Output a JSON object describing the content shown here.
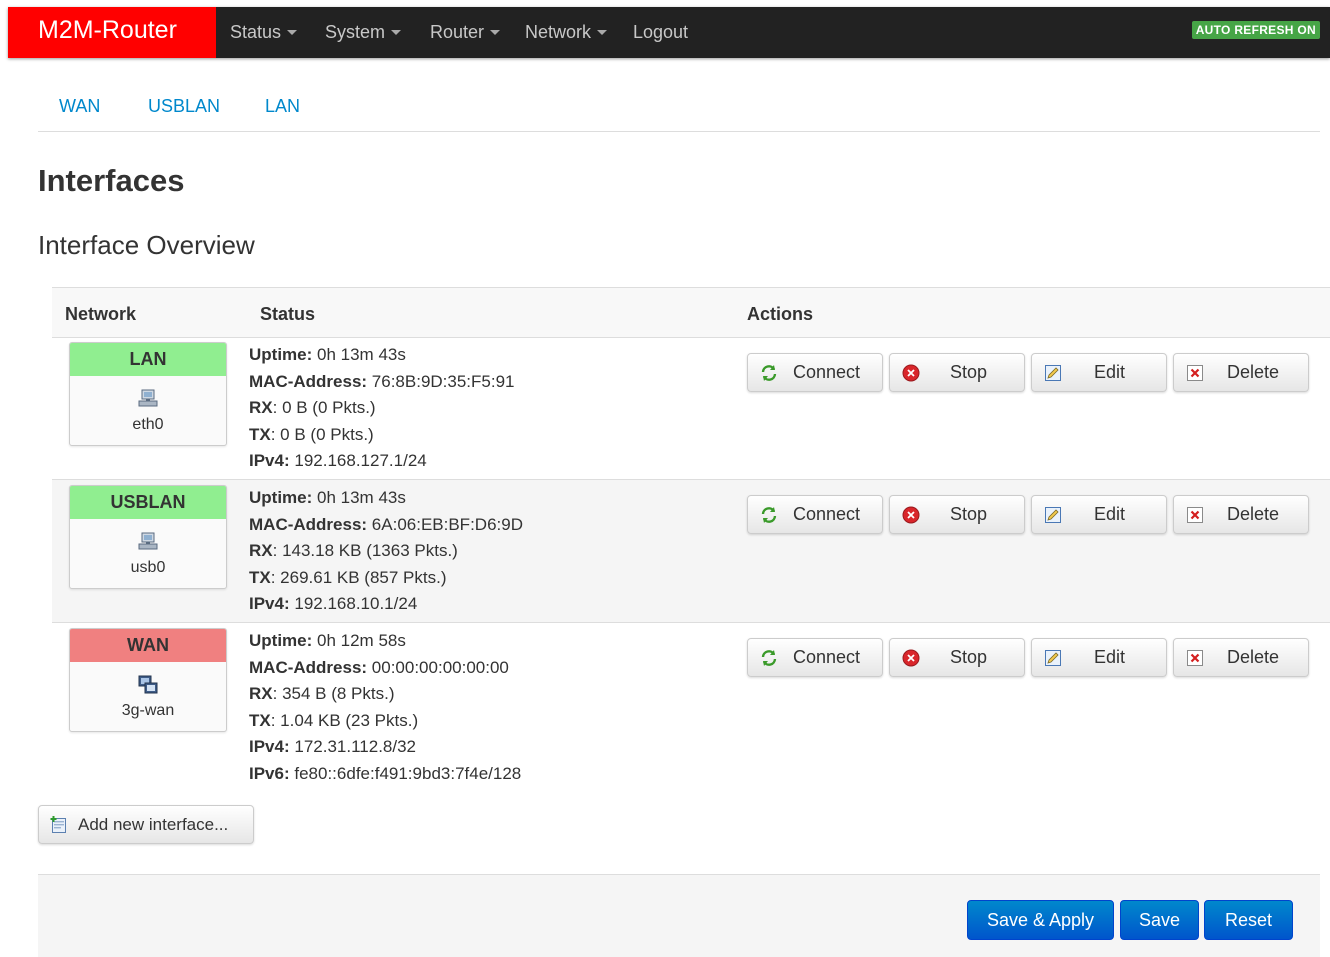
{
  "navbar": {
    "brand": "M2M-Router",
    "menus": [
      "Status",
      "System",
      "Router",
      "Network"
    ],
    "logout": "Logout",
    "auto_refresh": "AUTO REFRESH ON"
  },
  "tabs": [
    "WAN",
    "USBLAN",
    "LAN"
  ],
  "page_title": "Interfaces",
  "section_title": "Interface Overview",
  "table": {
    "headers": {
      "network": "Network",
      "status": "Status",
      "actions": "Actions"
    },
    "labels": {
      "uptime": "Uptime:",
      "mac": "MAC-Address:",
      "rx": "RX",
      "tx": "TX",
      "ipv4": "IPv4:",
      "ipv6": "IPv6:"
    },
    "buttons": {
      "connect": "Connect",
      "stop": "Stop",
      "edit": "Edit",
      "delete": "Delete"
    },
    "rows": [
      {
        "name": "LAN",
        "state_color": "#90ee90",
        "device": "eth0",
        "device_icon": "ethernet-icon",
        "uptime": "0h 13m 43s",
        "mac": "76:8B:9D:35:F5:91",
        "rx": ": 0 B (0 Pkts.)",
        "tx": ": 0 B (0 Pkts.)",
        "ipv4": "192.168.127.1/24",
        "ipv6": ""
      },
      {
        "name": "USBLAN",
        "state_color": "#90ee90",
        "device": "usb0",
        "device_icon": "ethernet-icon",
        "uptime": "0h 13m 43s",
        "mac": "6A:06:EB:BF:D6:9D",
        "rx": ": 143.18 KB (1363 Pkts.)",
        "tx": ": 269.61 KB (857 Pkts.)",
        "ipv4": "192.168.10.1/24",
        "ipv6": ""
      },
      {
        "name": "WAN",
        "state_color": "#f08080",
        "device": "3g-wan",
        "device_icon": "network-computer-icon",
        "uptime": "0h 12m 58s",
        "mac": "00:00:00:00:00:00",
        "rx": ": 354 B (8 Pkts.)",
        "tx": ": 1.04 KB (23 Pkts.)",
        "ipv4": "172.31.112.8/32",
        "ipv6": "fe80::6dfe:f491:9bd3:7f4e/128"
      }
    ]
  },
  "add_interface": "Add new interface...",
  "footer": {
    "save_apply": "Save & Apply",
    "save": "Save",
    "reset": "Reset"
  },
  "colors": {
    "brand": "#ff0000",
    "link": "#0088cc",
    "primary": "#006dcc",
    "up": "#90ee90",
    "down": "#f08080"
  }
}
